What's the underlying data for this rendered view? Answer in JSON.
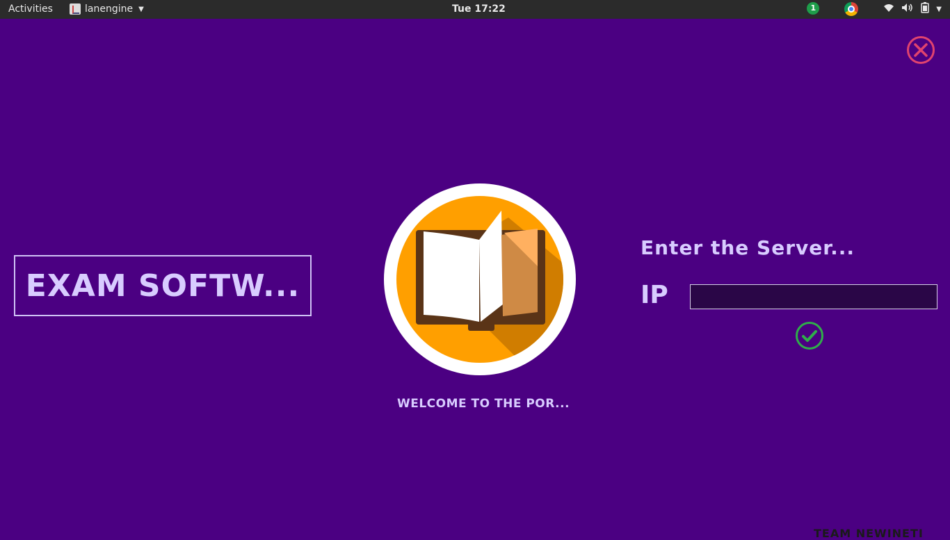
{
  "topbar": {
    "activities": "Activities",
    "app_name": "lanengine",
    "clock": "Tue 17:22",
    "notification_count": "1"
  },
  "main": {
    "title": "EXAM SOFTW...",
    "welcome": "WELCOME TO THE POR...",
    "server_prompt": "Enter the Server...",
    "ip_label": "IP",
    "ip_value": "",
    "footer": "TEAM NEWINETI"
  },
  "colors": {
    "background": "#4b0082",
    "text": "#d8ccff",
    "close": "#e0436e",
    "confirm": "#2fae4a",
    "logo_orange": "#ff9f00"
  },
  "icons": {
    "close": "close-circle-icon",
    "confirm": "check-circle-icon",
    "logo": "open-book-icon"
  }
}
